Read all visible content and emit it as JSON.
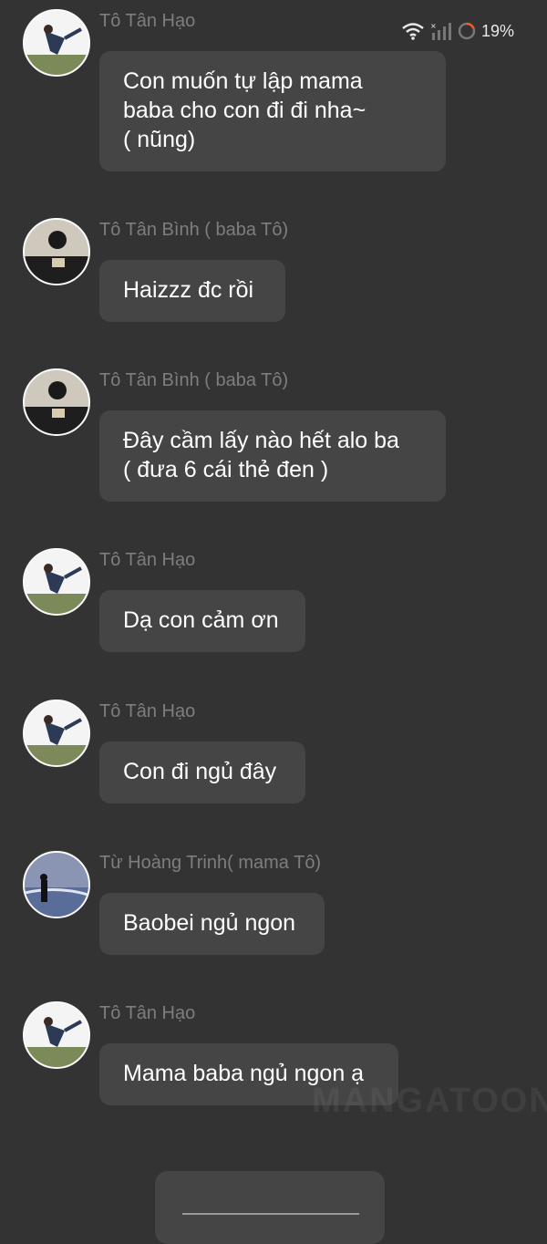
{
  "status_bar": {
    "battery": "19%",
    "battery_color": "#f05a28"
  },
  "messages": [
    {
      "sender": "Tô Tân Hạo",
      "text": "Con muốn tự lập mama\nbaba cho con đi đi nha~\n( nũng)"
    },
    {
      "sender": "Tô Tân Bình ( baba Tô)",
      "text": "Haizzz đc rồi"
    },
    {
      "sender": "Tô Tân Bình ( baba Tô)",
      "text": "Đây cầm lấy nào hết alo ba\n( đưa 6 cái thẻ đen )"
    },
    {
      "sender": "Tô Tân Hạo",
      "text": "Dạ con cảm ơn"
    },
    {
      "sender": "Tô Tân Hạo",
      "text": "Con đi ngủ đây"
    },
    {
      "sender": "Từ Hoàng Trinh( mama Tô)",
      "text": "Baobei ngủ ngon"
    },
    {
      "sender": "Tô Tân Hạo",
      "text": "Mama baba ngủ ngon ạ"
    }
  ],
  "watermark": "MANGATOON"
}
